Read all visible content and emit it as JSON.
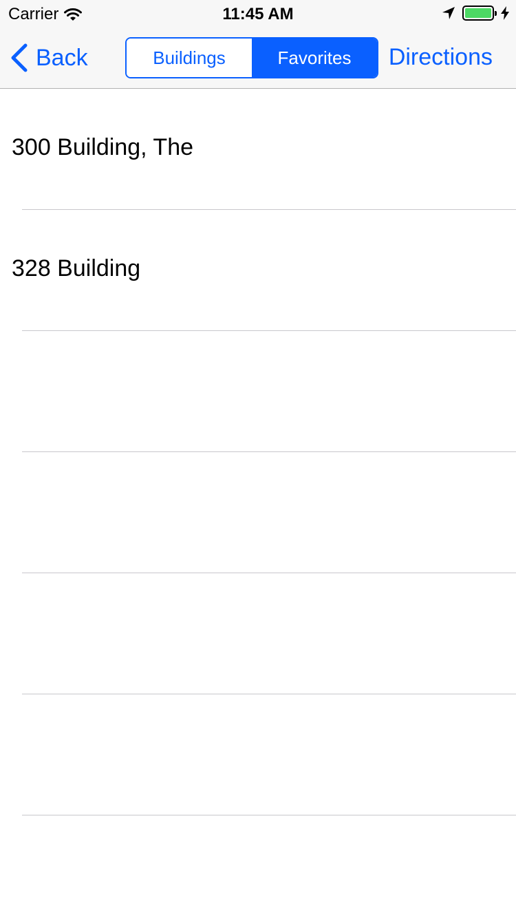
{
  "status_bar": {
    "carrier": "Carrier",
    "time": "11:45 AM",
    "icons": [
      "wifi-icon",
      "location-arrow-icon",
      "battery-icon",
      "charging-bolt-icon"
    ],
    "battery_color": "#4cd964"
  },
  "nav": {
    "back_label": "Back",
    "segments": [
      {
        "label": "Buildings",
        "selected": false
      },
      {
        "label": "Favorites",
        "selected": true
      }
    ],
    "directions_label": "Directions",
    "accent_color": "#0a60ff"
  },
  "list": {
    "items": [
      {
        "label": "300 Building, The"
      },
      {
        "label": "328 Building"
      },
      {
        "label": ""
      },
      {
        "label": ""
      },
      {
        "label": ""
      },
      {
        "label": ""
      },
      {
        "label": ""
      }
    ]
  }
}
